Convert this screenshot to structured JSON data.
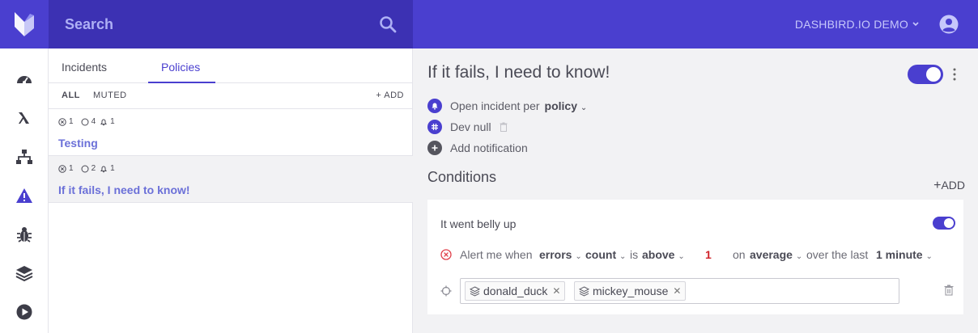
{
  "header": {
    "search_placeholder": "Search",
    "account_label": "DASHBIRD.IO DEMO",
    "brand_color": "#4a3fcf"
  },
  "nav": {
    "icons": [
      "dashboard-icon",
      "lambda-icon",
      "network-icon",
      "warning-icon",
      "bug-icon",
      "layers-icon",
      "play-icon"
    ]
  },
  "tabs": [
    {
      "label": "Incidents",
      "active": false
    },
    {
      "label": "Policies",
      "active": true
    }
  ],
  "filters": {
    "all": "ALL",
    "muted": "MUTED",
    "add": "ADD"
  },
  "policies": [
    {
      "name": "Testing",
      "errors": "1",
      "open": "4",
      "notifications": "1",
      "selected": false
    },
    {
      "name": "If it fails, I need to know!",
      "errors": "1",
      "open": "2",
      "notifications": "1",
      "selected": true
    }
  ],
  "detail": {
    "title": "If it fails, I need to know!",
    "enabled": true,
    "incident_per_prefix": "Open incident per",
    "incident_per_value": "policy",
    "channel": "Dev null",
    "add_notification": "Add notification",
    "conditions_title": "Conditions",
    "conditions_add": "ADD",
    "condition": {
      "name": "It went belly up",
      "enabled": true,
      "alert_prefix": "Alert me when",
      "metric": "errors",
      "aggregation": "count",
      "is": "is",
      "comparator": "above",
      "threshold": "1",
      "on": "on",
      "mode": "average",
      "over_the_last": "over the last",
      "window": "1 minute",
      "targets": [
        "donald_duck",
        "mickey_mouse"
      ]
    }
  }
}
